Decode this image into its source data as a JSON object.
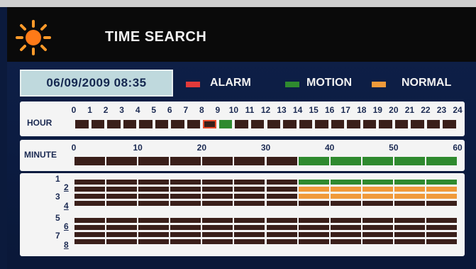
{
  "header": {
    "title": "TIME SEARCH",
    "icon": "sun-icon"
  },
  "datetime": "06/09/2009 08:35",
  "legend": [
    {
      "label": "ALARM",
      "color": "#e23a3a"
    },
    {
      "label": "MOTION",
      "color": "#2f8a2f"
    },
    {
      "label": "NORMAL",
      "color": "#f09a3a"
    }
  ],
  "colors": {
    "empty": "#3a1f1a",
    "motion": "#2f8a2f",
    "normal": "#f09a3a",
    "alarm": "#e23a3a",
    "selected_border": "#e84a2a"
  },
  "hour_bar": {
    "label": "HOUR",
    "ticks": [
      "0",
      "1",
      "2",
      "3",
      "4",
      "5",
      "6",
      "7",
      "8",
      "9",
      "10",
      "11",
      "12",
      "13",
      "14",
      "15",
      "16",
      "17",
      "18",
      "19",
      "20",
      "21",
      "22",
      "23",
      "24"
    ],
    "cells": [
      "empty",
      "empty",
      "empty",
      "empty",
      "empty",
      "empty",
      "empty",
      "empty",
      "selected",
      "motion",
      "empty",
      "empty",
      "empty",
      "empty",
      "empty",
      "empty",
      "empty",
      "empty",
      "empty",
      "empty",
      "empty",
      "empty",
      "empty",
      "empty"
    ]
  },
  "minute_bar": {
    "label": "MINUTE",
    "ticks": [
      "0",
      "10",
      "20",
      "30",
      "40",
      "50",
      "60"
    ],
    "cells": [
      "empty",
      "empty",
      "empty",
      "empty",
      "empty",
      "empty",
      "empty",
      "motion",
      "motion",
      "motion",
      "motion",
      "motion"
    ]
  },
  "channels": {
    "labels": [
      "1",
      "2",
      "3",
      "4",
      "5",
      "6",
      "7",
      "8"
    ],
    "rows": [
      [
        "empty",
        "empty",
        "empty",
        "empty",
        "empty",
        "empty",
        "empty",
        "motion",
        "motion",
        "motion",
        "motion",
        "motion"
      ],
      [
        "empty",
        "empty",
        "empty",
        "empty",
        "empty",
        "empty",
        "empty",
        "normal",
        "normal",
        "normal",
        "normal",
        "normal"
      ],
      [
        "empty",
        "empty",
        "empty",
        "empty",
        "empty",
        "empty",
        "empty",
        "normal",
        "normal",
        "normal",
        "normal",
        "normal"
      ],
      [
        "empty",
        "empty",
        "empty",
        "empty",
        "empty",
        "empty",
        "empty",
        "empty",
        "empty",
        "empty",
        "empty",
        "empty"
      ],
      [
        "empty",
        "empty",
        "empty",
        "empty",
        "empty",
        "empty",
        "empty",
        "empty",
        "empty",
        "empty",
        "empty",
        "empty"
      ],
      [
        "empty",
        "empty",
        "empty",
        "empty",
        "empty",
        "empty",
        "empty",
        "empty",
        "empty",
        "empty",
        "empty",
        "empty"
      ],
      [
        "empty",
        "empty",
        "empty",
        "empty",
        "empty",
        "empty",
        "empty",
        "empty",
        "empty",
        "empty",
        "empty",
        "empty"
      ],
      [
        "empty",
        "empty",
        "empty",
        "empty",
        "empty",
        "empty",
        "empty",
        "empty",
        "empty",
        "empty",
        "empty",
        "empty"
      ]
    ]
  }
}
